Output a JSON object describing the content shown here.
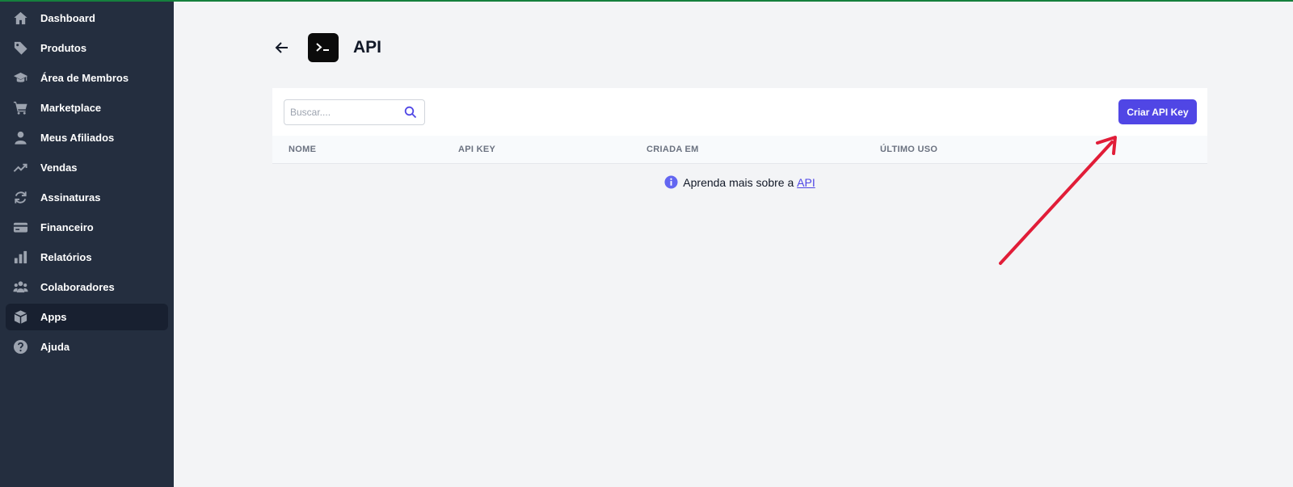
{
  "sidebar": {
    "items": [
      {
        "label": "Dashboard",
        "icon": "home-icon"
      },
      {
        "label": "Produtos",
        "icon": "tag-icon"
      },
      {
        "label": "Área de Membros",
        "icon": "graduation-cap-icon"
      },
      {
        "label": "Marketplace",
        "icon": "cart-icon"
      },
      {
        "label": "Meus Afiliados",
        "icon": "user-icon"
      },
      {
        "label": "Vendas",
        "icon": "trending-up-icon"
      },
      {
        "label": "Assinaturas",
        "icon": "refresh-icon"
      },
      {
        "label": "Financeiro",
        "icon": "credit-card-icon"
      },
      {
        "label": "Relatórios",
        "icon": "bar-chart-icon"
      },
      {
        "label": "Colaboradores",
        "icon": "users-icon"
      },
      {
        "label": "Apps",
        "icon": "cube-icon",
        "active": true
      },
      {
        "label": "Ajuda",
        "icon": "help-circle-icon"
      }
    ]
  },
  "header": {
    "title": "API"
  },
  "search": {
    "placeholder": "Buscar...."
  },
  "actions": {
    "create_label": "Criar API Key"
  },
  "table": {
    "columns": [
      "NOME",
      "API KEY",
      "CRIADA EM",
      "ÚLTIMO USO"
    ]
  },
  "info": {
    "text": "Aprenda mais sobre a",
    "link": "API"
  },
  "colors": {
    "sidebar_bg": "#242e3f",
    "accent": "#5046e5",
    "top_line": "#15803d",
    "annotation_arrow": "#e11d38"
  }
}
